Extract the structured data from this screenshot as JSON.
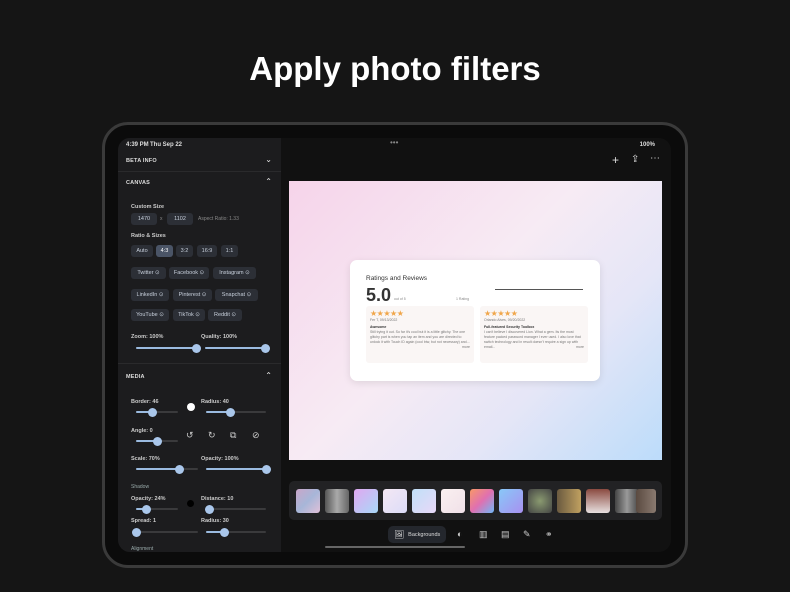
{
  "headline": "Apply photo filters",
  "status": {
    "time": "4:39 PM",
    "date": "Thu Sep 22",
    "battery": "100%"
  },
  "sidebar": {
    "beta_info": "BETA INFO",
    "canvas": {
      "title": "CANVAS",
      "custom_size": "Custom Size",
      "width": "1470",
      "x": "x",
      "height": "1102",
      "aspect": "Aspect Ratio: 1.33",
      "ratio_label": "Ratio & Sizes",
      "ratios": [
        "Auto",
        "4:3",
        "3:2",
        "16:9",
        "1:1"
      ],
      "selected_ratio": "4:3",
      "presets": [
        "Twitter",
        "Facebook",
        "Instagram",
        "LinkedIn",
        "Pinterest",
        "Snapchat",
        "YouTube",
        "TikTok",
        "Reddit"
      ],
      "zoom": {
        "label": "Zoom: 100%",
        "value": 1.0
      },
      "quality": {
        "label": "Quality: 100%",
        "value": 1.0
      }
    },
    "media": {
      "title": "MEDIA",
      "border": {
        "label": "Border: 46",
        "value": 0.4
      },
      "radius": {
        "label": "Radius: 40",
        "value": 0.4
      },
      "angle": {
        "label": "Angle: 0",
        "value": 0.5
      },
      "scale": {
        "label": "Scale: 70%",
        "value": 0.7
      },
      "opacity": {
        "label": "Opacity: 100%",
        "value": 1.0
      },
      "shadow_title": "Shadow",
      "shadow_opacity": {
        "label": "Opacity: 24%",
        "value": 0.24
      },
      "distance": {
        "label": "Distance: 10",
        "value": 0.05
      },
      "spread": {
        "label": "Spread: 1",
        "value": 0.01
      },
      "shadow_radius": {
        "label": "Radius: 30",
        "value": 0.3
      },
      "alignment": "Alignment"
    }
  },
  "card": {
    "title": "Ratings and Reviews",
    "score": "5.0",
    "out_of": "out of 5",
    "ratings": "1 Rating",
    "reviews": [
      {
        "stars": "★★★★★",
        "meta": "Fer T, 09/13/2022",
        "title": "Awesome",
        "body": "Still trying it out. So far it's cool but it is a little glitchy. The one glitchy part is when you tap an item and you are directed to unlock it with Touch ID again (cool btw, but not necessary) and...",
        "more": "more"
      },
      {
        "stars": "★★★★★",
        "meta": "Orlando Alves, 09/20/2022",
        "title": "Full-featured Security Toolbox",
        "body": "I can't believe I discovered Lion. What a gem. Its the most feature packed password manager I ever used. I also love that switch technology and in result doesn't require a sign up with email...",
        "more": "more"
      }
    ]
  },
  "toolbar": {
    "backgrounds": "Backgrounds"
  },
  "colors": {
    "accent": "#a9c6ea",
    "sidebar": "#1c1c1e"
  }
}
